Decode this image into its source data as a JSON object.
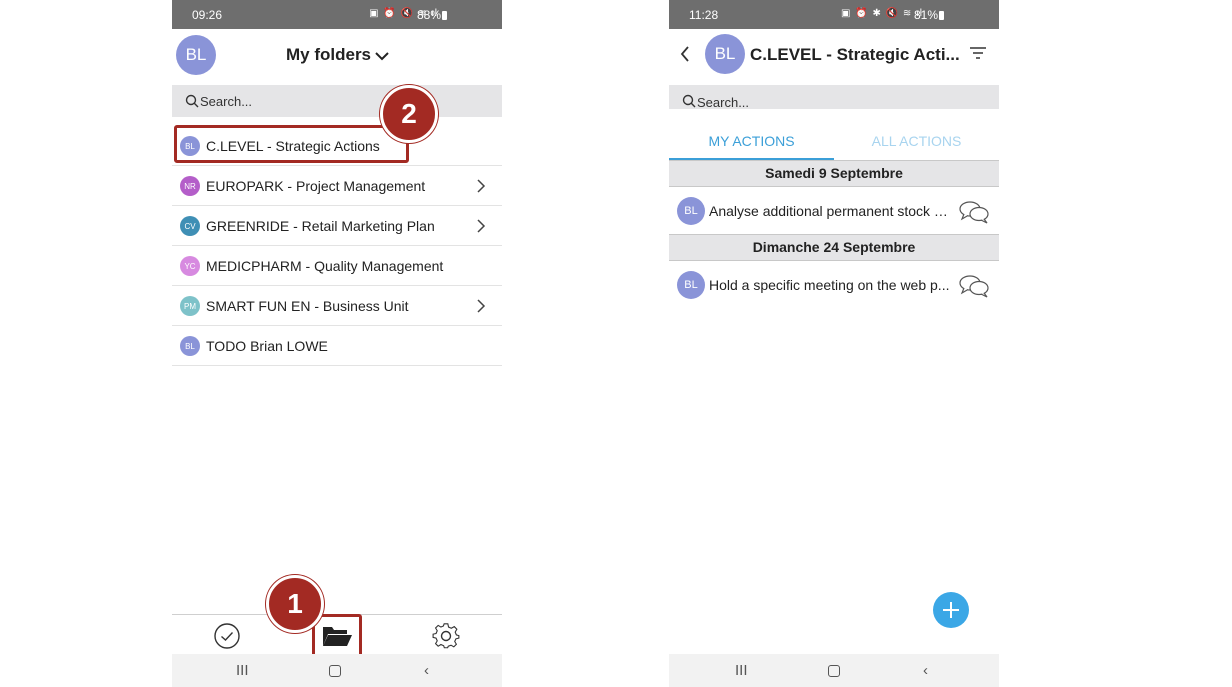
{
  "left_screen": {
    "status": {
      "time": "09:26",
      "battery": "88%"
    },
    "header": {
      "avatar": "BL",
      "title": "My folders"
    },
    "search": {
      "placeholder": "Search..."
    },
    "folders": [
      {
        "initials": "BL",
        "color": "#8a94d8",
        "label": "C.LEVEL - Strategic Actions",
        "has_chevron": false
      },
      {
        "initials": "NR",
        "color": "#b45ec9",
        "label": "EUROPARK - Project Management",
        "has_chevron": true
      },
      {
        "initials": "CV",
        "color": "#3f8fb5",
        "label": "GREENRIDE - Retail Marketing Plan",
        "has_chevron": true
      },
      {
        "initials": "YC",
        "color": "#d78ae0",
        "label": "MEDICPHARM - Quality Management",
        "has_chevron": false
      },
      {
        "initials": "PM",
        "color": "#7ec2c9",
        "label": "SMART FUN EN - Business Unit",
        "has_chevron": true
      },
      {
        "initials": "BL",
        "color": "#8a94d8",
        "label": "TODO Brian LOWE",
        "has_chevron": false
      }
    ],
    "callouts": {
      "one": "1",
      "two": "2"
    }
  },
  "right_screen": {
    "status": {
      "time": "11:28",
      "battery": "81%"
    },
    "header": {
      "avatar": "BL",
      "title": "C.LEVEL - Strategic Acti..."
    },
    "search": {
      "placeholder": "Search..."
    },
    "tabs": {
      "my_actions": "MY ACTIONS",
      "all_actions": "ALL ACTIONS"
    },
    "groups": [
      {
        "date": "Samedi 9 Septembre",
        "action": {
          "initials": "BL",
          "label": "Analyse additional permanent stock a..."
        }
      },
      {
        "date": "Dimanche 24 Septembre",
        "action": {
          "initials": "BL",
          "label": "Hold a specific meeting on the web p..."
        }
      }
    ]
  },
  "colors": {
    "accent_blue": "#3b9fd8",
    "callout_red": "#a32a23",
    "avatar_purple": "#8a94d8"
  }
}
